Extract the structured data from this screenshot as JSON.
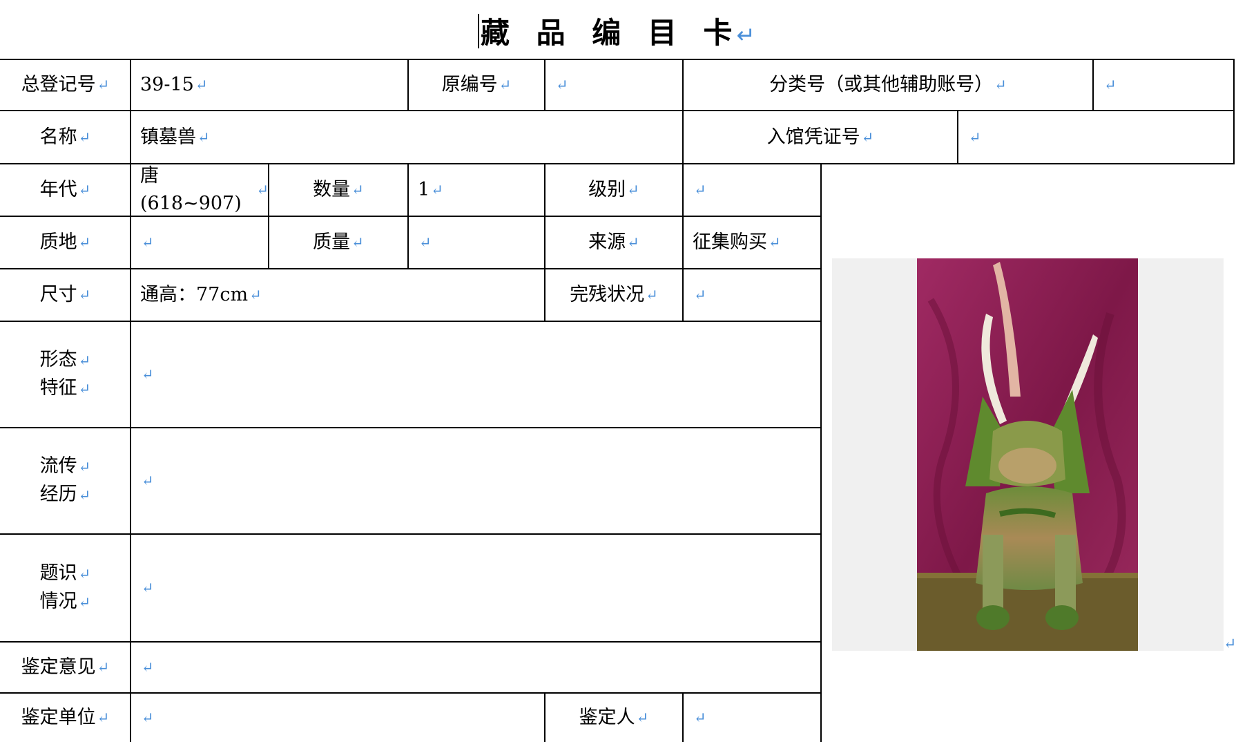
{
  "title": "藏 品 编 目 卡",
  "mark": "↵",
  "row1": {
    "reg_label": "总登记号",
    "reg_value": "39-15",
    "orig_label": "原编号",
    "orig_value": "",
    "class_label": "分类号（或其他辅助账号）",
    "class_value": ""
  },
  "row2": {
    "name_label": "名称",
    "name_value": "镇墓兽",
    "voucher_label": "入馆凭证号",
    "voucher_value": ""
  },
  "row3": {
    "era_label": "年代",
    "era_value": "唐(618~907)",
    "qty_label": "数量",
    "qty_value": "1",
    "grade_label": "级别",
    "grade_value": ""
  },
  "row4": {
    "material_label": "质地",
    "material_value": "",
    "weight_label": "质量",
    "weight_value": "",
    "source_label": "来源",
    "source_value": "征集购买"
  },
  "row5": {
    "size_label": "尺寸",
    "size_value": "通高：77cm",
    "condition_label": "完残状况",
    "condition_value": ""
  },
  "row6": {
    "label_1": "形态",
    "label_2": "特征",
    "value": ""
  },
  "row7": {
    "label_1": "流传",
    "label_2": "经历",
    "value": ""
  },
  "row8": {
    "label_1": "题识",
    "label_2": "情况",
    "value": ""
  },
  "row9": {
    "label": "鉴定意见",
    "value": ""
  },
  "row10": {
    "unit_label": "鉴定单位",
    "unit_value": "",
    "person_label": "鉴定人",
    "person_value": ""
  },
  "photo": {
    "subject": "tomb-guardian-beast",
    "colors": {
      "cloth": "#8e1d54",
      "glaze_green": "#4f7a2a",
      "glaze_amber": "#b9894a",
      "base": "#6a5a2a",
      "backdrop": "#f0f0f0"
    }
  },
  "colors": {
    "grid": "#000000",
    "mark": "#4a8fd9"
  }
}
